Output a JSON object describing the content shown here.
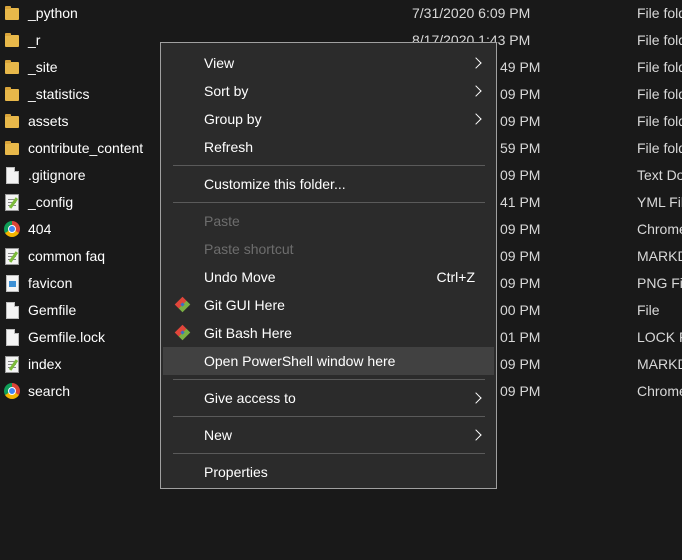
{
  "files": [
    {
      "name": "_python",
      "date": "7/31/2020 6:09 PM",
      "type": "File folder",
      "icon": "folder-icon"
    },
    {
      "name": "_r",
      "date": "8/17/2020 1:43 PM",
      "type": "File folder",
      "icon": "folder-icon"
    },
    {
      "name": "_site",
      "date": "49 PM",
      "type": "File folder",
      "icon": "folder-icon"
    },
    {
      "name": "_statistics",
      "date": "09 PM",
      "type": "File folder",
      "icon": "folder-icon"
    },
    {
      "name": "assets",
      "date": "09 PM",
      "type": "File folder",
      "icon": "folder-icon"
    },
    {
      "name": "contribute_content",
      "date": "59 PM",
      "type": "File folder",
      "icon": "folder-icon"
    },
    {
      "name": ".gitignore",
      "date": "09 PM",
      "type": "Text Document",
      "icon": "document-icon"
    },
    {
      "name": "_config",
      "date": "41 PM",
      "type": "YML File",
      "icon": "notepad-icon"
    },
    {
      "name": "404",
      "date": "09 PM",
      "type": "Chrome HTML",
      "icon": "chrome-icon"
    },
    {
      "name": "common faq",
      "date": "09 PM",
      "type": "MARKDOWN",
      "icon": "notepad-icon"
    },
    {
      "name": "favicon",
      "date": "09 PM",
      "type": "PNG File",
      "icon": "png-icon"
    },
    {
      "name": "Gemfile",
      "date": "00 PM",
      "type": "File",
      "icon": "document-icon"
    },
    {
      "name": "Gemfile.lock",
      "date": "01 PM",
      "type": "LOCK File",
      "icon": "document-icon"
    },
    {
      "name": "index",
      "date": "09 PM",
      "type": "MARKDOWN",
      "icon": "notepad-icon"
    },
    {
      "name": "search",
      "date": "09 PM",
      "type": "Chrome HTML",
      "icon": "chrome-icon"
    }
  ],
  "menu": {
    "view": "View",
    "sort_by": "Sort by",
    "group_by": "Group by",
    "refresh": "Refresh",
    "customize": "Customize this folder...",
    "paste": "Paste",
    "paste_shortcut": "Paste shortcut",
    "undo_move": "Undo Move",
    "undo_shortcut": "Ctrl+Z",
    "git_gui": "Git GUI Here",
    "git_bash": "Git Bash Here",
    "powershell": "Open PowerShell window here",
    "give_access": "Give access to",
    "new": "New",
    "properties": "Properties"
  },
  "colors": {
    "background": "#191919",
    "menu_background": "#2b2b2b",
    "highlight": "#414141",
    "folder": "#e8b84a"
  }
}
